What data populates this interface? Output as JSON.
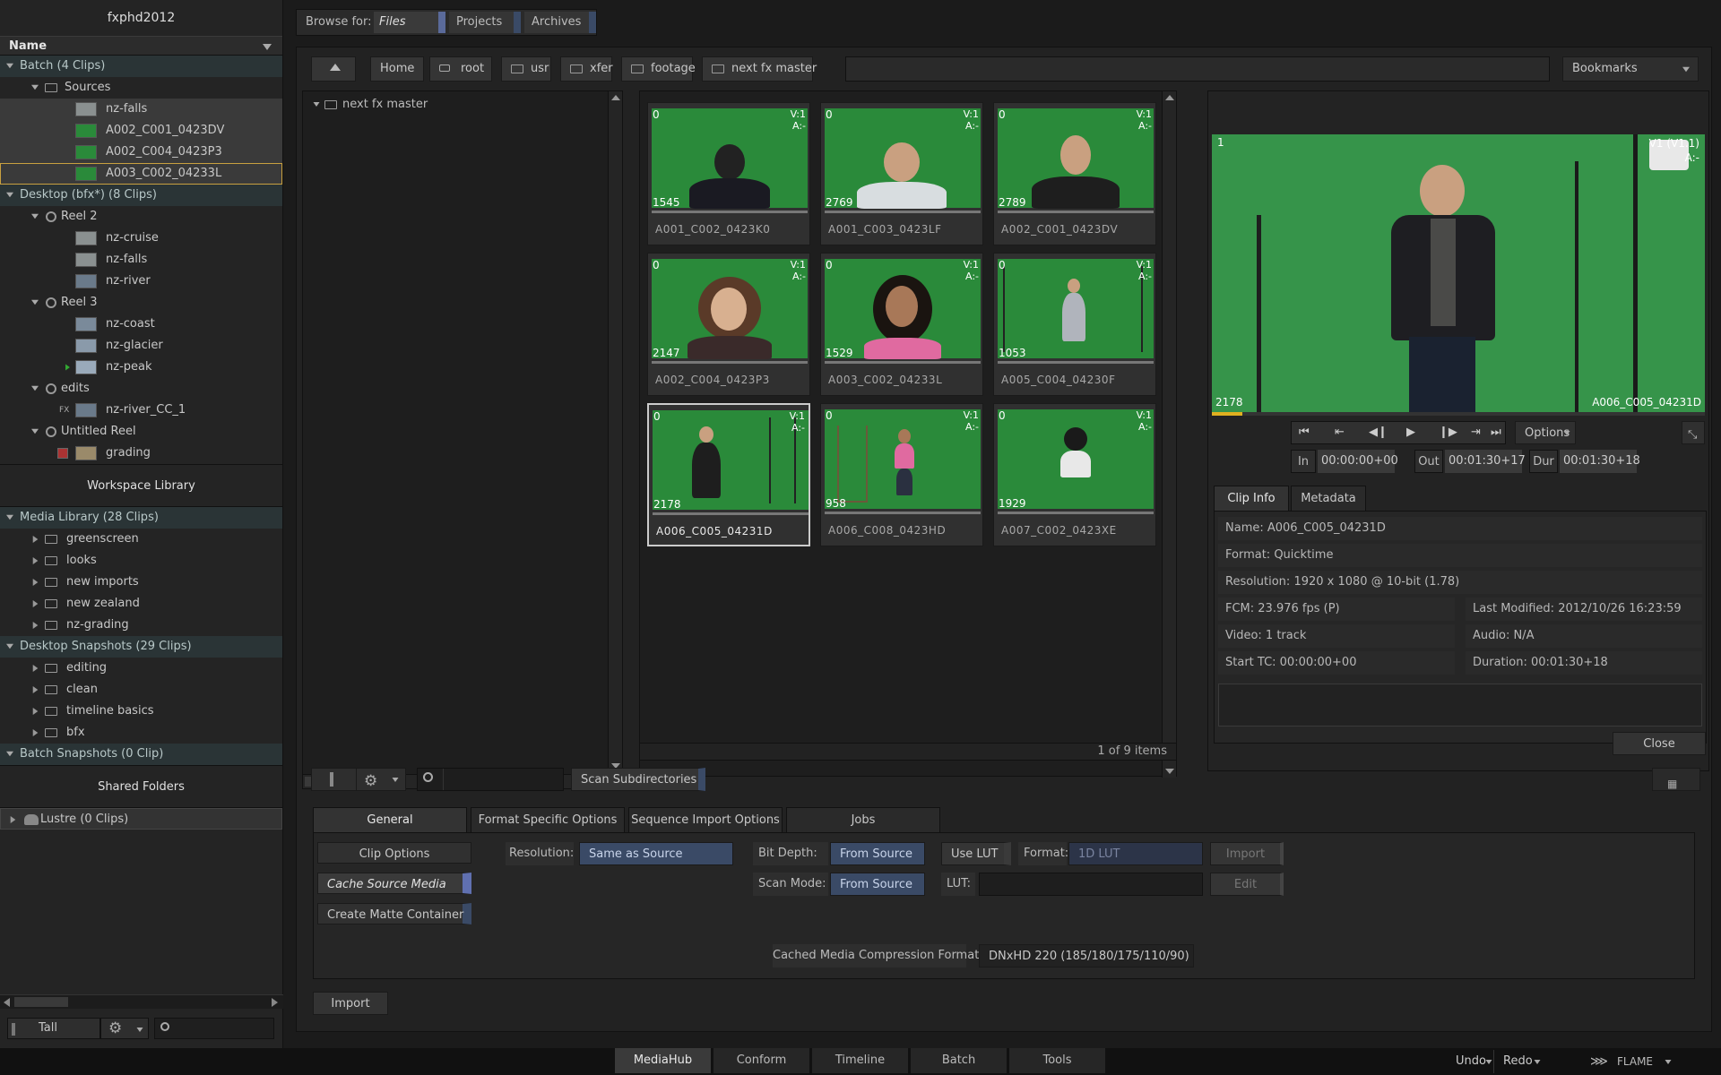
{
  "app": {
    "project": "fxphd2012",
    "product": "FLAME"
  },
  "left": {
    "name_header": "Name",
    "tree": [
      {
        "label": "Batch (4 Clips)"
      },
      {
        "label": "Sources"
      },
      {
        "label": "nz-falls"
      },
      {
        "label": "A002_C001_0423DV"
      },
      {
        "label": "A002_C004_0423P3"
      },
      {
        "label": "A003_C002_04233L"
      },
      {
        "label": "Desktop (bfx*) (8 Clips)"
      },
      {
        "label": "Reel 2"
      },
      {
        "label": "nz-cruise"
      },
      {
        "label": "nz-falls"
      },
      {
        "label": "nz-river"
      },
      {
        "label": "Reel 3"
      },
      {
        "label": "nz-coast"
      },
      {
        "label": "nz-glacier"
      },
      {
        "label": "nz-peak"
      },
      {
        "label": "edits"
      },
      {
        "label": "nz-river_CC_1",
        "badge": "FX"
      },
      {
        "label": "Untitled Reel"
      },
      {
        "label": "grading"
      }
    ],
    "workspace_library": "Workspace Library",
    "library_tree": [
      {
        "label": "Media Library (28 Clips)"
      },
      {
        "label": "greenscreen"
      },
      {
        "label": "looks"
      },
      {
        "label": "new imports"
      },
      {
        "label": "new zealand"
      },
      {
        "label": "nz-grading"
      },
      {
        "label": "Desktop Snapshots (29 Clips)"
      },
      {
        "label": "editing"
      },
      {
        "label": "clean"
      },
      {
        "label": "timeline basics"
      },
      {
        "label": "bfx"
      },
      {
        "label": "Batch Snapshots (0 Clip)"
      }
    ],
    "shared_folders": "Shared Folders",
    "lustre": "Lustre (0 Clips)",
    "layout_select": "Tall"
  },
  "browse": {
    "label": "Browse for:",
    "options": [
      "Files",
      "Projects",
      "Archives"
    ]
  },
  "path": {
    "home": "Home",
    "crumbs": [
      "root",
      "usr",
      "xfer",
      "footage",
      "next fx master"
    ],
    "bookmarks": "Bookmarks"
  },
  "folder_tree": {
    "root": "next fx master"
  },
  "grid": {
    "clips": [
      {
        "name": "A001_C002_0423K0",
        "count": "1545",
        "start": "0",
        "v": "V:1",
        "a": "A:-"
      },
      {
        "name": "A001_C003_0423LF",
        "count": "2769",
        "start": "0",
        "v": "V:1",
        "a": "A:-"
      },
      {
        "name": "A002_C001_0423DV",
        "count": "2789",
        "start": "0",
        "v": "V:1",
        "a": "A:-"
      },
      {
        "name": "A002_C004_0423P3",
        "count": "2147",
        "start": "0",
        "v": "V:1",
        "a": "A:-"
      },
      {
        "name": "A003_C002_04233L",
        "count": "1529",
        "start": "0",
        "v": "V:1",
        "a": "A:-"
      },
      {
        "name": "A005_C004_04230F",
        "count": "1053",
        "start": "0",
        "v": "V:1",
        "a": "A:-"
      },
      {
        "name": "A006_C005_04231D",
        "count": "2178",
        "start": "0",
        "v": "V:1",
        "a": "A:-"
      },
      {
        "name": "A006_C008_0423HD",
        "count": "958",
        "start": "0",
        "v": "V:1",
        "a": "A:-"
      },
      {
        "name": "A007_C002_0423XE",
        "count": "1929",
        "start": "0",
        "v": "V:1",
        "a": "A:-"
      }
    ],
    "status": "1 of 9 items"
  },
  "viewer": {
    "frame": "1",
    "track": "V1 (V1.1)",
    "audio": "A:-",
    "count": "2178",
    "clip": "A006_C005_04231D",
    "options": "Options",
    "in_label": "In",
    "in": "00:00:00+00",
    "out_label": "Out",
    "out": "00:01:30+17",
    "dur_label": "Dur",
    "dur": "00:01:30+18"
  },
  "clipinfo": {
    "tabs": [
      "Clip Info",
      "Metadata"
    ],
    "name": "Name: A006_C005_04231D",
    "format": "Format: Quicktime",
    "resolution": "Resolution: 1920 x 1080 @ 10-bit (1.78)",
    "fcm": "FCM: 23.976 fps (P)",
    "modified": "Last Modified: 2012/10/26 16:23:59",
    "video": "Video: 1 track",
    "audio": "Audio: N/A",
    "start_tc": "Start TC: 00:00:00+00",
    "duration": "Duration: 00:01:30+18",
    "close": "Close"
  },
  "toolbar": {
    "scan": "Scan Subdirectories"
  },
  "options": {
    "tabs": [
      "General",
      "Format Specific Options",
      "Sequence Import Options",
      "Jobs"
    ],
    "clip_options": "Clip Options",
    "cache_source": "Cache Source Media",
    "create_matte": "Create Matte Container",
    "resolution_label": "Resolution:",
    "resolution": "Same as Source",
    "bitdepth_label": "Bit Depth:",
    "bitdepth": "From Source",
    "scanmode_label": "Scan Mode:",
    "scanmode": "From Source",
    "use_lut": "Use LUT",
    "format_label": "Format:",
    "format": "1D LUT",
    "import_btn": "Import",
    "lut_label": "LUT:",
    "edit_btn": "Edit",
    "cached_label": "Cached Media Compression Format",
    "cached_value": "DNxHD 220 (185/180/175/110/90)"
  },
  "import_button": "Import",
  "bottom_tabs": [
    "MediaHub",
    "Conform",
    "Timeline",
    "Batch",
    "Tools"
  ],
  "undo": "Undo",
  "redo": "Redo",
  "colors": {
    "green": "#2a8a3a",
    "accent": "#3a4a66",
    "highlight": "#c8a040"
  }
}
